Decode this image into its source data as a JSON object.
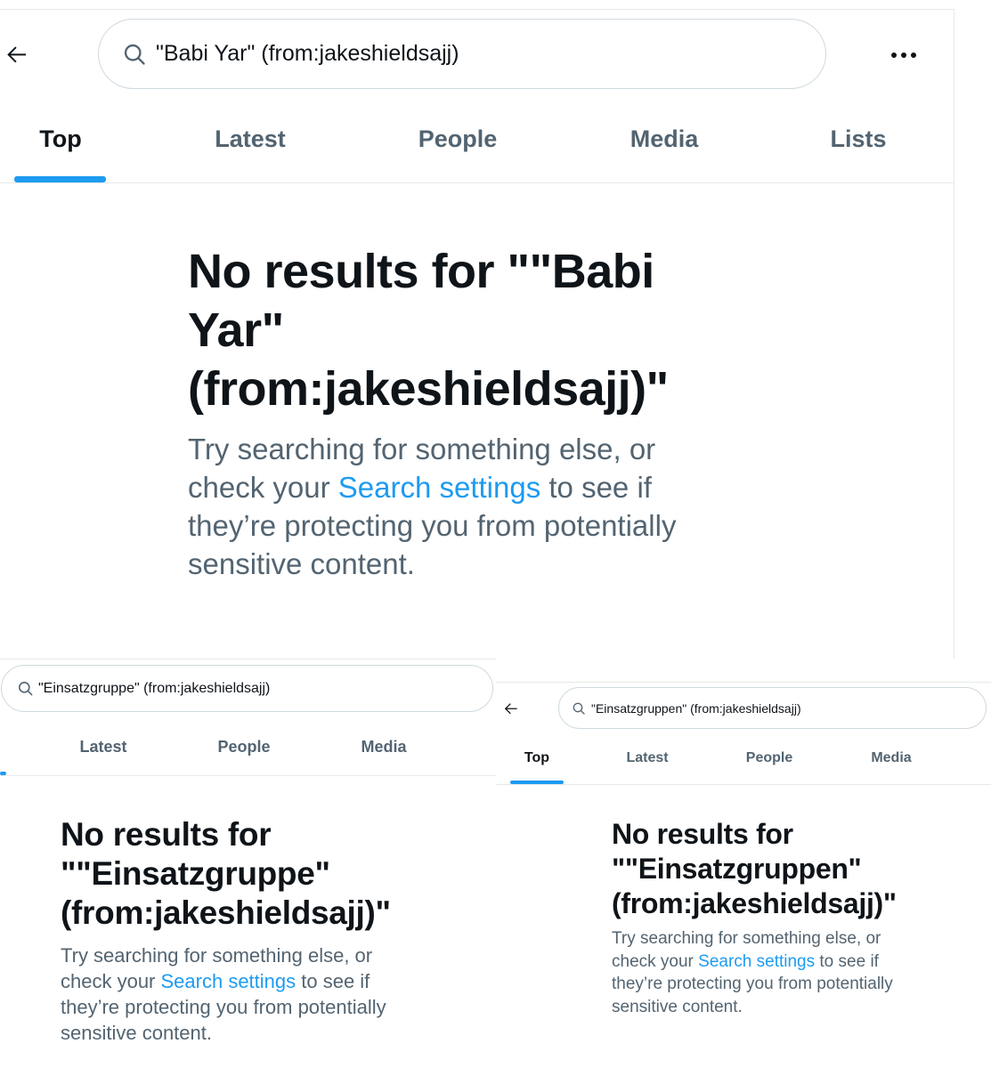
{
  "panels": [
    {
      "search_query": "\"Babi Yar\" (from:jakeshieldsajj)",
      "tabs": [
        {
          "label": "Top",
          "active": true
        },
        {
          "label": "Latest",
          "active": false
        },
        {
          "label": "People",
          "active": false
        },
        {
          "label": "Media",
          "active": false
        },
        {
          "label": "Lists",
          "active": false
        }
      ],
      "empty_state": {
        "title_line1": "No results for \"\"Babi",
        "title_line2": "Yar\"",
        "title_line3": "(from:jakeshieldsajj)\"",
        "body_line1": "Try searching for something else, or",
        "body_line2_before": "check your ",
        "body_link": "Search settings",
        "body_line2_after": " to see if",
        "body_line3": "they’re protecting you from potentially",
        "body_line4": "sensitive content."
      }
    },
    {
      "search_query": "\"Einsatzgruppe\" (from:jakeshieldsajj)",
      "tabs": [
        {
          "label": "Latest",
          "active": false
        },
        {
          "label": "People",
          "active": false
        },
        {
          "label": "Media",
          "active": false
        }
      ],
      "empty_state": {
        "title_line1": "No results for",
        "title_line2": "\"\"Einsatzgruppe\"",
        "title_line3": "(from:jakeshieldsajj)\"",
        "body_line1": "Try searching for something else, or",
        "body_line2_before": "check your ",
        "body_link": "Search settings",
        "body_line2_after": " to see if",
        "body_line3": "they’re protecting you from potentially",
        "body_line4": "sensitive content."
      }
    },
    {
      "search_query": "\"Einsatzgruppen\" (from:jakeshieldsajj)",
      "tabs": [
        {
          "label": "Top",
          "active": true
        },
        {
          "label": "Latest",
          "active": false
        },
        {
          "label": "People",
          "active": false
        },
        {
          "label": "Media",
          "active": false
        }
      ],
      "empty_state": {
        "title_line1": "No results for",
        "title_line2": "\"\"Einsatzgruppen\"",
        "title_line3": "(from:jakeshieldsajj)\"",
        "body_line1": "Try searching for something else, or",
        "body_line2_before": "check your ",
        "body_link": "Search settings",
        "body_line2_after": " to see if",
        "body_line3": "they’re protecting you from potentially",
        "body_line4": "sensitive content."
      }
    }
  ],
  "colors": {
    "accent": "#1d9bf0",
    "text_primary": "#0f1419",
    "text_secondary": "#536471",
    "border": "#cfd9de"
  },
  "icons": {
    "back": "arrow-left-icon",
    "search": "search-icon",
    "more": "more-horizontal-icon"
  }
}
